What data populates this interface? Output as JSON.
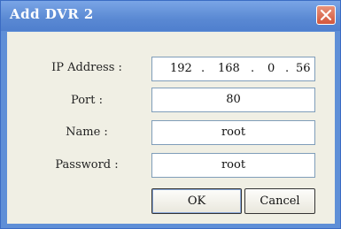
{
  "window": {
    "title": "Add DVR 2"
  },
  "fields": {
    "ip": {
      "label": "IP Address :",
      "octets": [
        "192",
        "168",
        "0",
        "56"
      ],
      "separator": "."
    },
    "port": {
      "label": "Port :",
      "value": "80"
    },
    "name": {
      "label": "Name :",
      "value": "root"
    },
    "password": {
      "label": "Password :",
      "value": "root"
    }
  },
  "buttons": {
    "ok": "OK",
    "cancel": "Cancel"
  },
  "icons": {
    "close": "close-icon"
  },
  "colors": {
    "titlebar": "#5a89d3",
    "close": "#d2563c",
    "client": "#f0efe4"
  }
}
